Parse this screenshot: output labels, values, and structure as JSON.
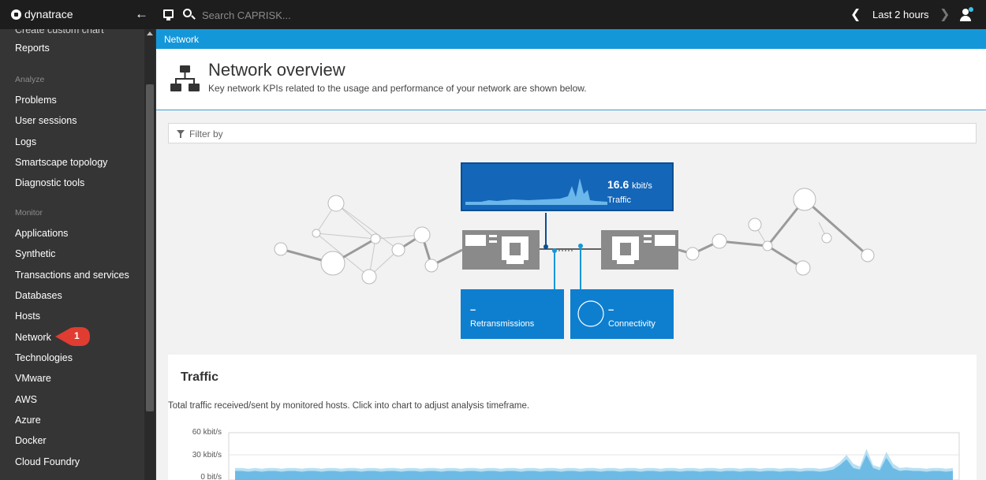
{
  "app": {
    "name": "dynatrace"
  },
  "topbar": {
    "search_placeholder": "Search CAPRISK...",
    "timeframe": "Last 2 hours"
  },
  "sidebar": {
    "cut_item": "Create custom chart",
    "items_top": [
      "Reports"
    ],
    "analyze_heading": "Analyze",
    "analyze_items": [
      "Problems",
      "User sessions",
      "Logs",
      "Smartscape topology",
      "Diagnostic tools"
    ],
    "monitor_heading": "Monitor",
    "monitor_items": [
      "Applications",
      "Synthetic",
      "Transactions and services",
      "Databases",
      "Hosts",
      "Network",
      "Technologies",
      "VMware",
      "AWS",
      "Azure",
      "Docker",
      "Cloud Foundry"
    ],
    "annotation_badge": "1"
  },
  "breadcrumb": "Network",
  "header": {
    "title": "Network overview",
    "subtitle": "Key network KPIs related to the usage and performance of your network are shown below."
  },
  "filter": {
    "placeholder": "Filter by"
  },
  "tiles": {
    "traffic": {
      "value": "16.6",
      "unit": "kbit/s",
      "label": "Traffic"
    },
    "retransmissions": {
      "value": "–",
      "label": "Retransmissions"
    },
    "connectivity": {
      "value": "–",
      "label": "Connectivity"
    }
  },
  "traffic_card": {
    "title": "Traffic",
    "description": "Total traffic received/sent by monitored hosts. Click into chart to adjust analysis timeframe."
  },
  "chart_data": {
    "type": "area",
    "ylabels": [
      "60 kbit/s",
      "30 kbit/s",
      "0 bit/s"
    ],
    "ylim": [
      0,
      60
    ],
    "y_unit": "kbit/s",
    "series": [
      {
        "values": [
          12,
          12,
          11,
          12,
          11,
          12,
          12,
          11,
          12,
          12,
          11,
          12,
          12,
          11,
          12,
          12,
          11,
          12,
          12,
          11,
          12,
          12,
          11,
          12,
          12,
          11,
          12,
          12,
          11,
          12,
          12,
          11,
          12,
          12,
          11,
          12,
          12,
          11,
          12,
          12,
          11,
          12,
          12,
          11,
          12,
          12,
          11,
          12,
          12,
          11,
          12,
          12,
          11,
          12,
          12,
          11,
          12,
          12,
          11,
          12,
          12,
          11,
          12,
          12,
          11,
          12,
          12,
          11,
          12,
          12,
          11,
          12,
          12,
          11,
          12,
          12,
          11,
          12,
          12,
          11,
          12,
          12,
          11,
          12,
          12,
          11,
          12,
          12,
          11,
          12,
          14,
          20,
          30,
          18,
          14,
          38,
          16,
          13,
          34,
          18,
          12,
          13,
          12,
          12,
          11,
          12,
          12,
          11,
          12
        ]
      },
      {
        "values": [
          8,
          8,
          7,
          8,
          7,
          8,
          8,
          7,
          8,
          8,
          7,
          8,
          8,
          7,
          8,
          8,
          7,
          8,
          8,
          7,
          8,
          8,
          7,
          8,
          8,
          7,
          8,
          8,
          7,
          8,
          8,
          7,
          8,
          8,
          7,
          8,
          8,
          7,
          8,
          8,
          7,
          8,
          8,
          7,
          8,
          8,
          7,
          8,
          8,
          7,
          8,
          8,
          7,
          8,
          8,
          7,
          8,
          8,
          7,
          8,
          8,
          7,
          8,
          8,
          7,
          8,
          8,
          7,
          8,
          8,
          7,
          8,
          8,
          7,
          8,
          8,
          7,
          8,
          8,
          7,
          8,
          8,
          7,
          8,
          8,
          7,
          8,
          8,
          7,
          8,
          10,
          16,
          24,
          12,
          10,
          30,
          12,
          9,
          26,
          12,
          8,
          9,
          8,
          8,
          7,
          8,
          8,
          7,
          8
        ]
      }
    ],
    "colors": [
      "#a8d8f0",
      "#5fb4e2"
    ]
  },
  "colors": {
    "accent": "#1497d9",
    "topbar": "#1d1d1d",
    "sidebar": "#353535",
    "badge": "#e03c31"
  }
}
